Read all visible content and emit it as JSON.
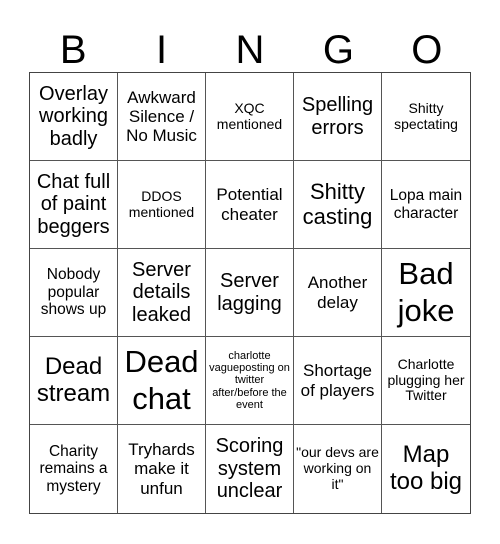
{
  "header": {
    "letters": [
      "B",
      "I",
      "N",
      "G",
      "O"
    ]
  },
  "cells": [
    "Overlay working badly",
    "Awkward Silence / No Music",
    "XQC mentioned",
    "Spelling errors",
    "Shitty spectating",
    "Chat full of paint beggers",
    "DDOS mentioned",
    "Potential cheater",
    "Shitty casting",
    "Lopa main character",
    "Nobody popular shows up",
    "Server details leaked",
    "Server lagging",
    "Another delay",
    "Bad joke",
    "Dead stream",
    "Dead chat",
    "charlotte vagueposting on twitter after/before the event",
    "Shortage of players",
    "Charlotte plugging her Twitter",
    "Charity remains a mystery",
    "Tryhards make it unfun",
    "Scoring system unclear",
    "\"our devs are working on it\"",
    "Map too big"
  ]
}
